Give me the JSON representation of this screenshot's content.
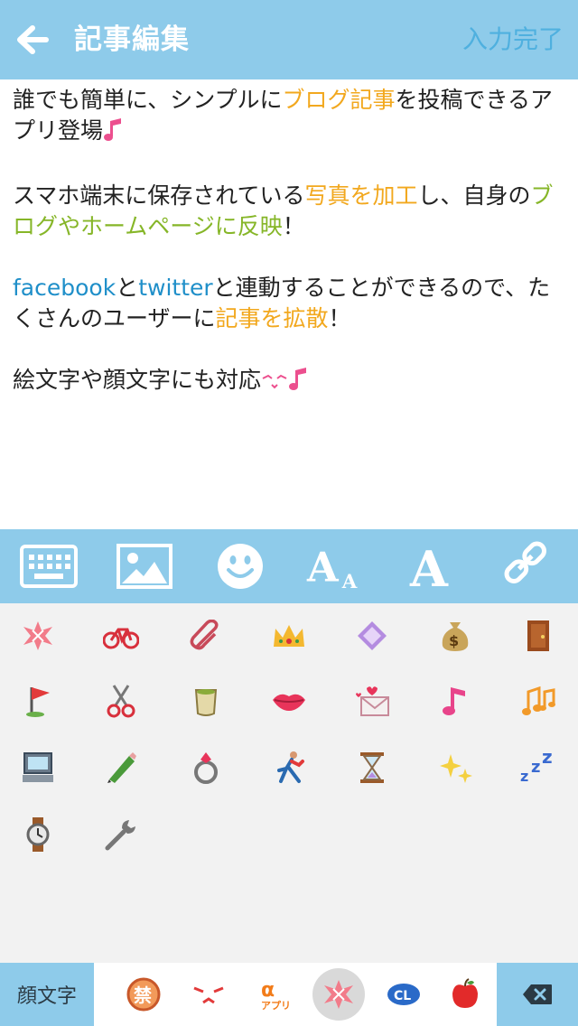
{
  "header": {
    "title": "記事編集",
    "done_label": "入力完了"
  },
  "article": {
    "p1": {
      "a": "誰でも簡単に、シンプルに",
      "hl": "ブログ記事",
      "b": "を投稿できるアプリ登場"
    },
    "p2": {
      "a": "スマホ端末に保存されている",
      "hl1": "写真を加工",
      "b": "し、自身の",
      "hl2": "ブログやホームページに反映",
      "c": "！"
    },
    "p3": {
      "fb": "facebook",
      "a": "と",
      "tw": "twitter",
      "b": "と連動することができるので、たくさんのユーザーに",
      "hl": "記事を拡散",
      "c": "！"
    },
    "p4": {
      "a": "絵文字や顔文字にも対応"
    }
  },
  "toolbar": {
    "items": [
      "keyboard-icon",
      "image-icon",
      "smiley-icon",
      "font-size-icon",
      "font-style-icon",
      "link-icon"
    ]
  },
  "emoji_grid": {
    "items": [
      "anger-icon",
      "bicycle-icon",
      "paperclip-icon",
      "crown-icon",
      "diamond-icon",
      "money-bag-icon",
      "door-icon",
      "flag-icon",
      "scissors-icon",
      "tea-icon",
      "lips-icon",
      "love-letter-icon",
      "note-icon",
      "notes-icon",
      "computer-icon",
      "pencil-icon",
      "ring-icon",
      "runner-icon",
      "hourglass-icon",
      "sparkles-icon",
      "zzz-icon",
      "watch-icon",
      "wrench-icon"
    ]
  },
  "bottom": {
    "kaomoji_label": "顔文字",
    "categories": [
      "prohibited-icon",
      "angry-face-icon",
      "app-icon",
      "anger-icon",
      "cl-icon",
      "apple-icon"
    ],
    "active_index": 3
  },
  "colors": {
    "accent": "#8ecbea",
    "done": "#4fb0df",
    "highlight_orange": "#f2a81e",
    "highlight_green": "#86b628",
    "link_blue": "#1f8fc9"
  }
}
